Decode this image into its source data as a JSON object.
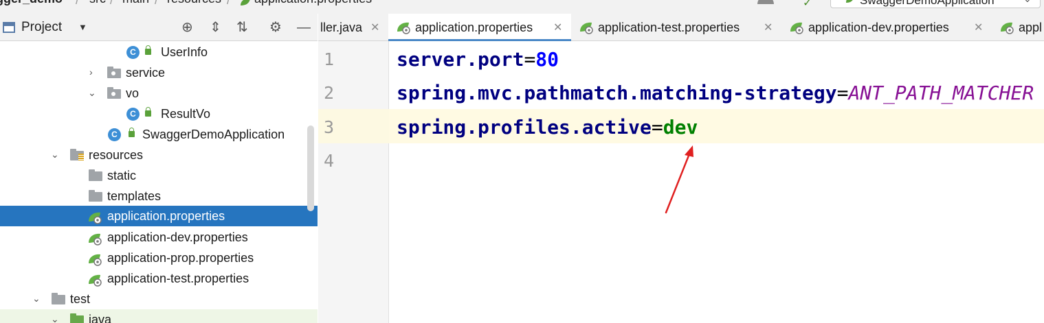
{
  "breadcrumb": {
    "project": "gger_demo",
    "items": [
      "src",
      "main",
      "resources",
      "application.properties"
    ]
  },
  "toolbar": {
    "run_config": "SwaggerDemoApplication"
  },
  "project_panel": {
    "title": "Project"
  },
  "tree": [
    {
      "label": "UserInfo",
      "type": "class"
    },
    {
      "label": "service",
      "type": "package",
      "expanded": false
    },
    {
      "label": "vo",
      "type": "package",
      "expanded": true
    },
    {
      "label": "ResultVo",
      "type": "class"
    },
    {
      "label": "SwaggerDemoApplication",
      "type": "spring-class"
    },
    {
      "label": "resources",
      "type": "resources-folder",
      "expanded": true
    },
    {
      "label": "static",
      "type": "folder"
    },
    {
      "label": "templates",
      "type": "folder"
    },
    {
      "label": "application.properties",
      "type": "properties",
      "selected": true
    },
    {
      "label": "application-dev.properties",
      "type": "properties"
    },
    {
      "label": "application-prop.properties",
      "type": "properties"
    },
    {
      "label": "application-test.properties",
      "type": "properties"
    },
    {
      "label": "test",
      "type": "folder",
      "expanded": true
    },
    {
      "label": "java",
      "type": "test-source-folder",
      "expanded": true
    }
  ],
  "tabs": [
    {
      "label": "ller.java",
      "active": false
    },
    {
      "label": "application.properties",
      "active": true
    },
    {
      "label": "application-test.properties",
      "active": false
    },
    {
      "label": "application-dev.properties",
      "active": false
    },
    {
      "label": "appl",
      "active": false
    }
  ],
  "editor": {
    "line_numbers": [
      "1",
      "2",
      "3",
      "4"
    ],
    "lines": [
      {
        "key": "server.port",
        "eq": "=",
        "value": "80"
      },
      {
        "key": "spring.mvc.pathmatch.matching-strategy",
        "eq": "=",
        "value": "ANT_PATH_MATCHER"
      },
      {
        "key": "spring.profiles.active",
        "eq": "=",
        "value": "dev"
      }
    ],
    "caret_line": 3
  },
  "colors": {
    "selection": "#2675bf",
    "key": "#000080",
    "number": "#0000ff",
    "enum": "#871094",
    "string": "#008000",
    "arrow": "#e02020"
  }
}
